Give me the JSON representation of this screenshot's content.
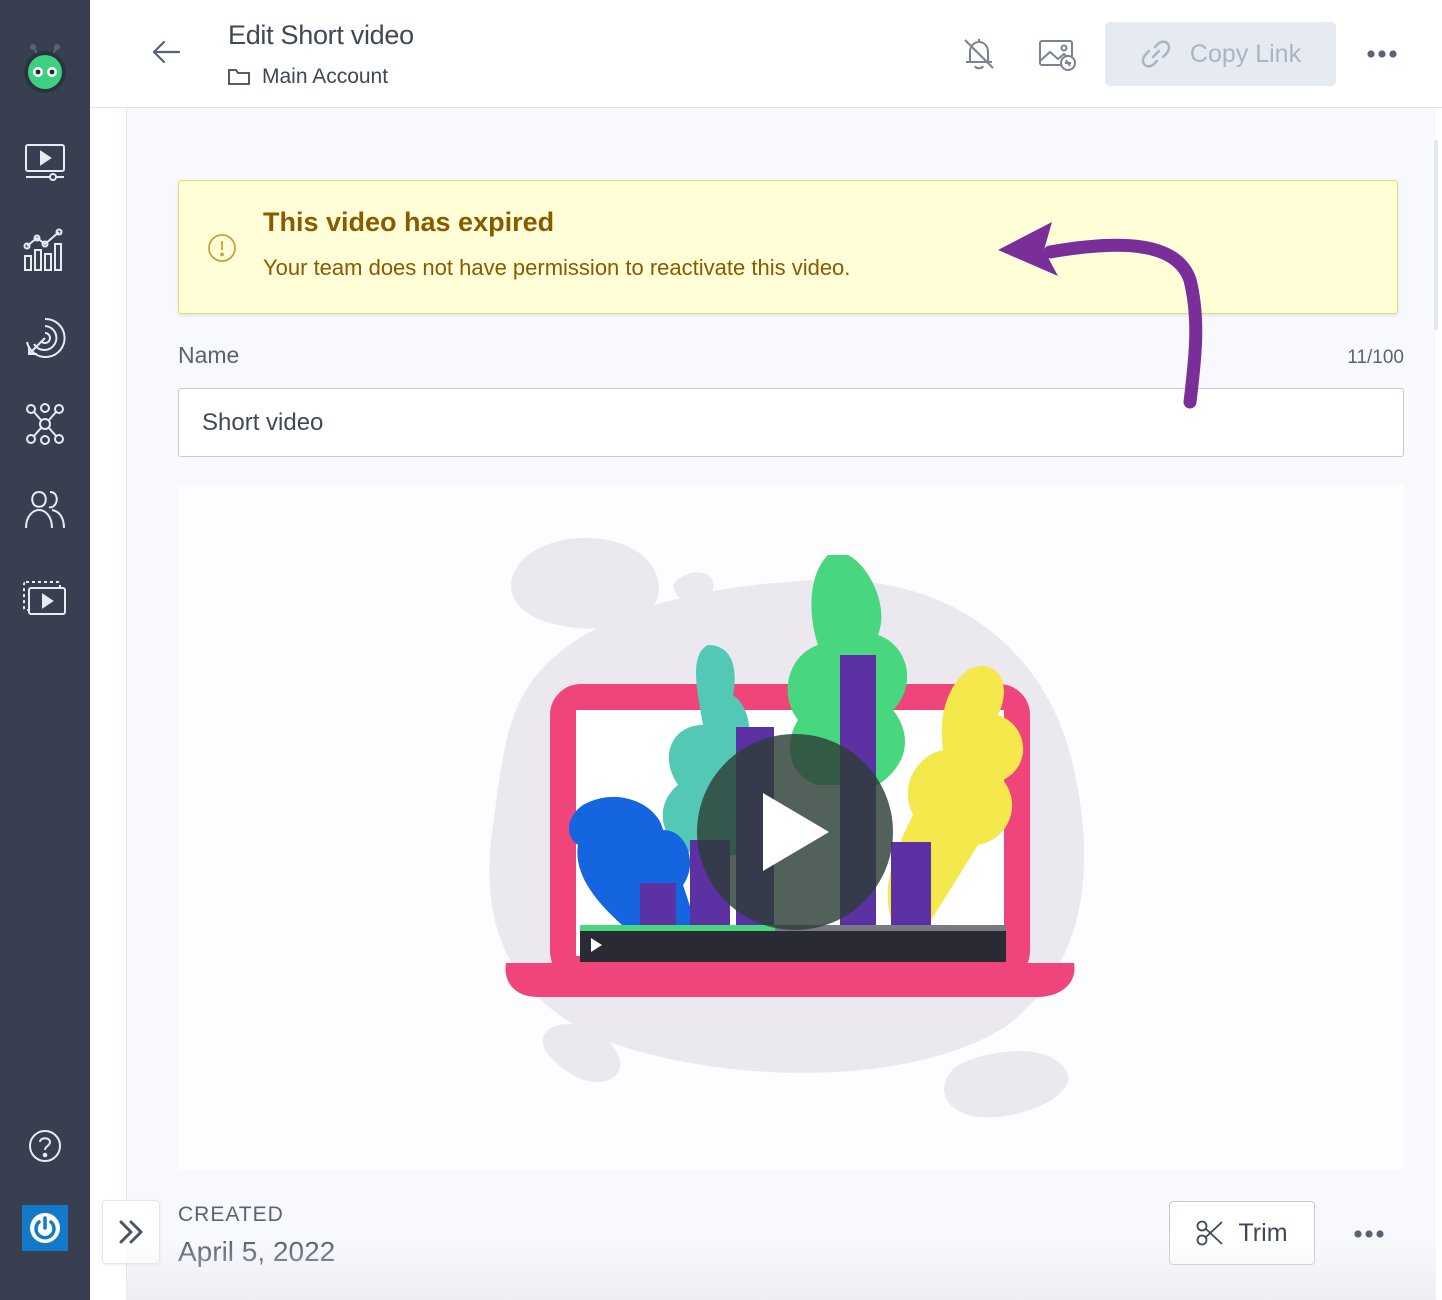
{
  "header": {
    "title": "Edit Short video",
    "folder": "Main Account",
    "copy_link_label": "Copy Link"
  },
  "alert": {
    "title": "This video has expired",
    "message": "Your team does not have permission to reactivate this video."
  },
  "name_field": {
    "label": "Name",
    "value": "Short video",
    "char_count": "11/100"
  },
  "footer": {
    "created_label": "CREATED",
    "created_date": "April 5, 2022",
    "trim_label": "Trim"
  },
  "sidebar": {
    "items": [
      "videos-icon",
      "analytics-icon",
      "engagement-icon",
      "integrations-icon",
      "contacts-icon",
      "screen-recording-icon",
      "help-icon",
      "power-icon"
    ]
  },
  "colors": {
    "sidebar_bg": "#373f50",
    "alert_bg": "#fffed6",
    "alert_text": "#8a5a00",
    "annotation_arrow": "#7a2e9a",
    "power_bg": "#1379c9"
  }
}
